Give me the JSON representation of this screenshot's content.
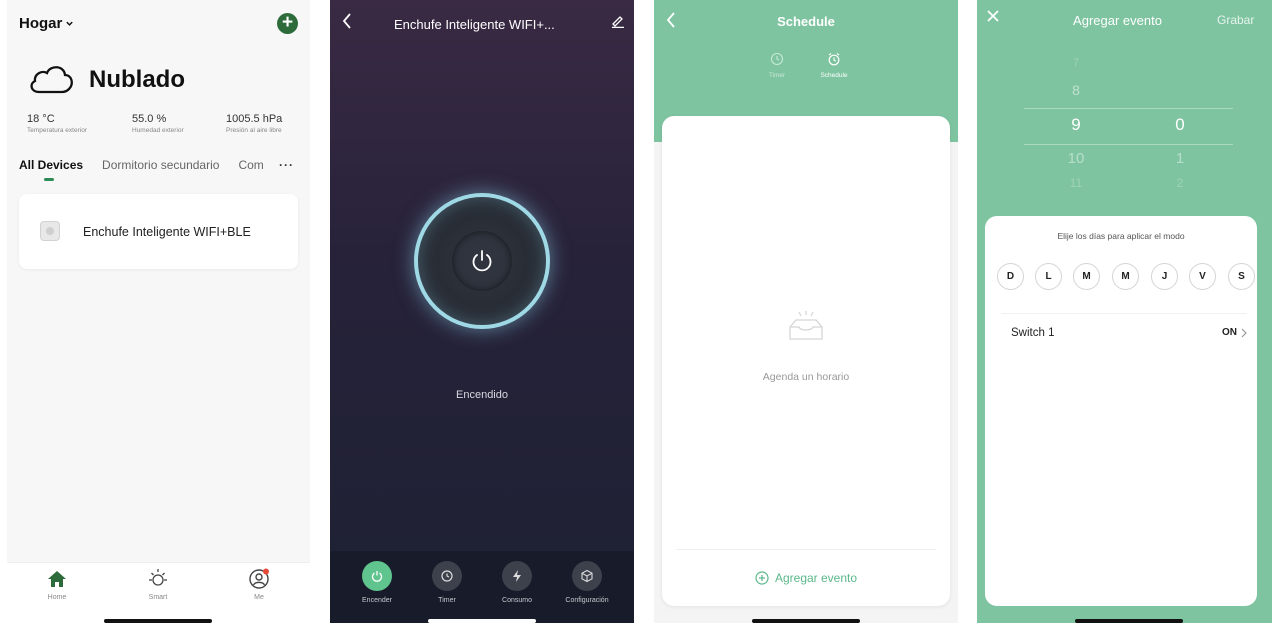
{
  "home": {
    "title": "Hogar",
    "weather": {
      "condition": "Nublado"
    },
    "stats": [
      {
        "value": "18 °C",
        "label": "Temperatura exterior"
      },
      {
        "value": "55.0 %",
        "label": "Humedad exterior"
      },
      {
        "value": "1005.5 hPa",
        "label": "Presión al aire libre"
      }
    ],
    "tabs": [
      "All Devices",
      "Dormitorio secundario",
      "Com"
    ],
    "tab_more": "···",
    "device": {
      "name": "Enchufe Inteligente WIFI+BLE"
    },
    "nav": [
      {
        "label": "Home",
        "icon": "home-icon"
      },
      {
        "label": "Smart",
        "icon": "sun-icon"
      },
      {
        "label": "Me",
        "icon": "user-icon"
      }
    ],
    "colors": {
      "accent": "#2e6b3a",
      "background": "#f7f7f7"
    }
  },
  "device_screen": {
    "title": "Enchufe Inteligente WIFI+...",
    "status": "Encendido",
    "bottom": [
      {
        "label": "Encender",
        "icon": "power-icon"
      },
      {
        "label": "Timer",
        "icon": "timer-icon"
      },
      {
        "label": "Consumo",
        "icon": "bolt-icon"
      },
      {
        "label": "Configuración",
        "icon": "cube-icon"
      }
    ],
    "colors": {
      "ring": "#9fd9e6",
      "active": "#5fc48d"
    }
  },
  "schedule": {
    "title": "Schedule",
    "tabs": [
      {
        "label": "Timer",
        "icon": "clock-icon"
      },
      {
        "label": "Schedule",
        "icon": "alarm-icon"
      }
    ],
    "empty_text": "Agenda un horario",
    "add_label": "Agregar evento",
    "colors": {
      "header": "#7ec4a0",
      "link": "#5cb88a"
    }
  },
  "add_event": {
    "title": "Agregar evento",
    "save_label": "Grabar",
    "hours": [
      "7",
      "8",
      "9",
      "10",
      "11"
    ],
    "minutes": [
      "0",
      "1",
      "2"
    ],
    "selected_hour": "9",
    "selected_minute": "0",
    "days_title": "Elije los días para aplicar el modo",
    "days": [
      "D",
      "L",
      "M",
      "M",
      "J",
      "V",
      "S"
    ],
    "switch_label": "Switch 1",
    "switch_value": "ON"
  }
}
